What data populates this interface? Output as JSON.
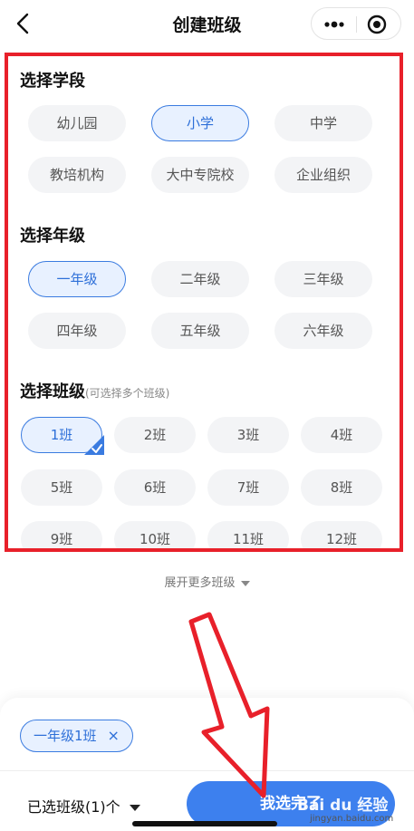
{
  "nav": {
    "title": "创建班级"
  },
  "stage": {
    "title": "选择学段",
    "options": [
      "幼儿园",
      "小学",
      "中学",
      "教培机构",
      "大中专院校",
      "企业组织"
    ],
    "selected": "小学"
  },
  "grade": {
    "title": "选择年级",
    "options": [
      "一年级",
      "二年级",
      "三年级",
      "四年级",
      "五年级",
      "六年级"
    ],
    "selected": "一年级"
  },
  "class_section": {
    "title": "选择班级",
    "hint": "(可选择多个班级)",
    "options": [
      "1班",
      "2班",
      "3班",
      "4班",
      "5班",
      "6班",
      "7班",
      "8班",
      "9班",
      "10班",
      "11班",
      "12班"
    ],
    "selected": "1班"
  },
  "expand_label": "展开更多班级",
  "selection": {
    "tag_label": "一年级1班",
    "remove_symbol": "×",
    "count_label": "已选班级(1)个",
    "done_label": "我选完了"
  },
  "watermark": {
    "brand": "Bai du 经验",
    "site": "jingyan.baidu.com"
  },
  "colors": {
    "accent": "#3d80ee",
    "highlight_border": "#e8202a",
    "selected_bg": "#e8f1ff"
  }
}
